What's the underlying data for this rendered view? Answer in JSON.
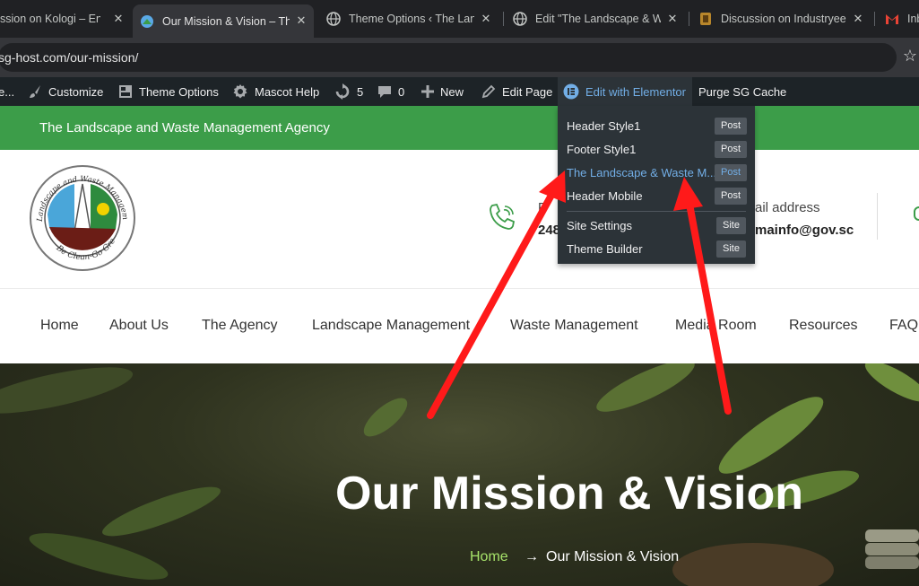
{
  "browser": {
    "tabs": [
      {
        "title": "ssion on Kologi – Env"
      },
      {
        "title": "Our Mission & Vision – Th"
      },
      {
        "title": "Theme Options ‹ The Land"
      },
      {
        "title": "Edit \"The Landscape & Wa"
      },
      {
        "title": "Discussion on Industryee"
      },
      {
        "title": "Inb"
      }
    ],
    "url": "sg-host.com/our-mission/"
  },
  "adminbar": {
    "ellipsis": "e...",
    "customize": "Customize",
    "theme_options": "Theme Options",
    "mascot_help": "Mascot Help",
    "updates_count": "5",
    "comments_count": "0",
    "new": "New",
    "edit_page": "Edit Page",
    "edit_elementor": "Edit with Elementor",
    "purge_cache": "Purge SG Cache"
  },
  "elementor_menu": {
    "items": [
      {
        "label": "Header Style1",
        "type": "Post"
      },
      {
        "label": "Footer Style1",
        "type": "Post"
      },
      {
        "label": "The Landscape & Waste M...",
        "type": "Post"
      },
      {
        "label": "Header Mobile",
        "type": "Post"
      },
      {
        "label": "Site Settings",
        "type": "Site"
      },
      {
        "label": "Theme Builder",
        "type": "Site"
      }
    ]
  },
  "site": {
    "agency_name": "The Landscape and Waste Management Agency",
    "phone_label": "P",
    "phone_value": "248",
    "email_label": "ail address",
    "email_value": "mainfo@gov.sc",
    "logo_text_top": "Landscape and Waste Management Agency",
    "logo_text_bottom": "Be Clean-Go Green"
  },
  "nav": {
    "items": [
      "Home",
      "About Us",
      "The Agency",
      "Landscape Management",
      "Waste Management",
      "Media Room",
      "Resources",
      "FAQ"
    ]
  },
  "hero": {
    "title": "Our Mission & Vision",
    "breadcrumb_home": "Home",
    "breadcrumb_sep": "→",
    "breadcrumb_current": "Our Mission & Vision"
  },
  "colors": {
    "green": "#3c9d49",
    "adminbar": "#1d2327",
    "link_blue": "#72aee6",
    "breadcrumb_home": "#a6e36a",
    "arrow_red": "#ff1a1a"
  }
}
